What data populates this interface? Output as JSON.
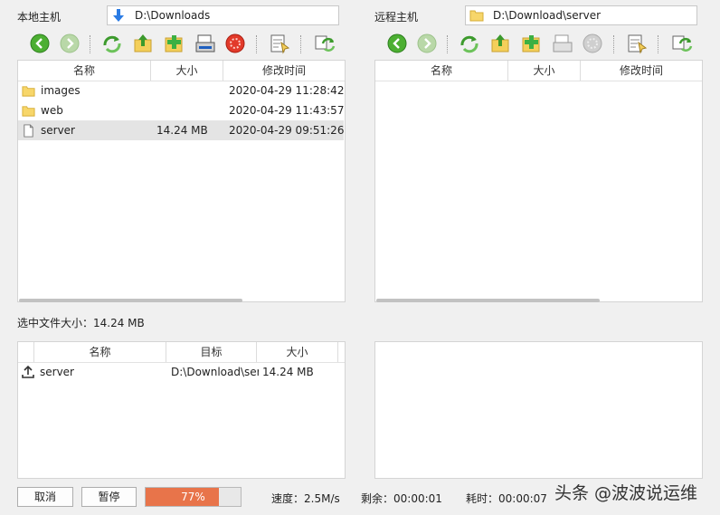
{
  "local": {
    "label": "本地主机",
    "path": "D:\\Downloads",
    "columns": [
      "名称",
      "大小",
      "修改时间"
    ],
    "files": [
      {
        "name": "images",
        "size": "",
        "mtime": "2020-04-29 11:28:42",
        "type": "folder"
      },
      {
        "name": "web",
        "size": "",
        "mtime": "2020-04-29 11:43:57",
        "type": "folder"
      },
      {
        "name": "server",
        "size": "14.24 MB",
        "mtime": "2020-04-29 09:51:26",
        "type": "file",
        "selected": true
      }
    ]
  },
  "remote": {
    "label": "远程主机",
    "path": "D:\\Download\\server",
    "columns": [
      "名称",
      "大小",
      "修改时间"
    ]
  },
  "selected_size": "选中文件大小：14.24 MB",
  "queue": {
    "columns": [
      "名称",
      "目标",
      "大小"
    ],
    "items": [
      {
        "name": "server",
        "target": "D:\\Download\\ser",
        "size": "14.24 MB"
      }
    ]
  },
  "controls": {
    "cancel": "取消",
    "pause": "暂停",
    "progress_text": "77%",
    "progress_value": 0.77,
    "speed": "速度：2.5M/s",
    "remaining": "剩余：00:00:01",
    "elapsed": "耗时：00:00:07"
  },
  "watermark": "头条 @波波说运维",
  "colors": {
    "progress": "#e8744a",
    "folder": "#f7d66a",
    "green": "#3cb043"
  }
}
